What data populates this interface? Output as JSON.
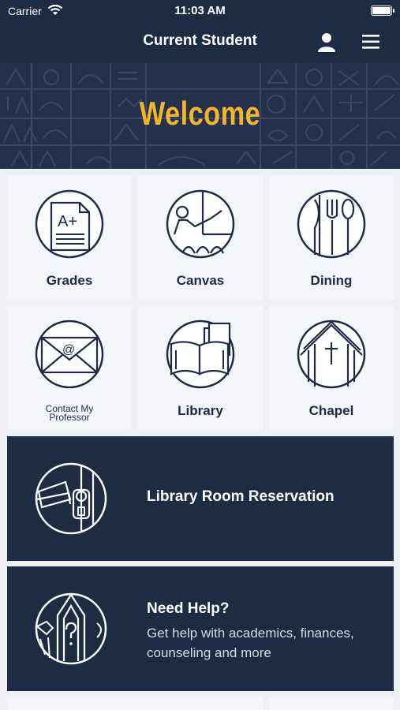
{
  "status": {
    "carrier": "Carrier",
    "time": "11:03 AM"
  },
  "nav": {
    "title": "Current Student"
  },
  "banner": {
    "welcome": "Welcome"
  },
  "tiles": [
    {
      "label": "Grades",
      "icon": "grades-icon"
    },
    {
      "label": "Canvas",
      "icon": "canvas-icon"
    },
    {
      "label": "Dining",
      "icon": "dining-icon"
    },
    {
      "label": "Contact My Professor",
      "icon": "envelope-icon"
    },
    {
      "label": "Library",
      "icon": "library-icon"
    },
    {
      "label": "Chapel",
      "icon": "chapel-icon"
    }
  ],
  "wide_cards": [
    {
      "title": "Library Room Reservation",
      "icon": "door-icon"
    },
    {
      "title": "Need Help?",
      "subtitle": "Get help with academics, finances, counseling and more",
      "icon": "help-icon"
    }
  ],
  "colors": {
    "navy": "#1f2a44",
    "gold": "#f2b62a",
    "tile_bg": "#f4f5f8"
  }
}
